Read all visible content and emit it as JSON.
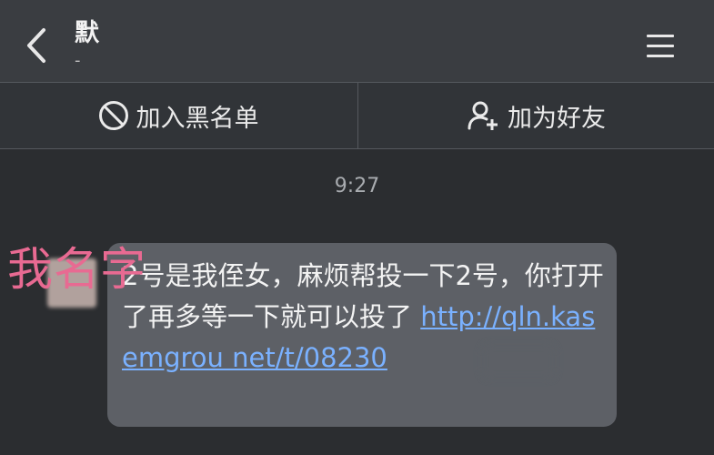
{
  "header": {
    "title": "默",
    "subtitle": "-",
    "back_icon": "chevron-left-icon",
    "menu_icon": "hamburger-menu-icon"
  },
  "actions": {
    "block_label": "加入黑名单",
    "block_icon": "block-icon",
    "add_friend_label": "加为好友",
    "add_friend_icon": "add-user-icon"
  },
  "chat": {
    "timestamp": "9:27",
    "overlay_name": "我名字",
    "message": {
      "text": "2号是我侄女，麻烦帮投一下2号，你打开了再多等一下就可以投了",
      "link": "http://qln.kasemgrou  net/t/08230"
    }
  },
  "colors": {
    "background": "#2b2d30",
    "header": "#3a3d41",
    "bubble": "#5d6066",
    "link": "#7ab1ff",
    "overlay_name": "#e86a92"
  }
}
